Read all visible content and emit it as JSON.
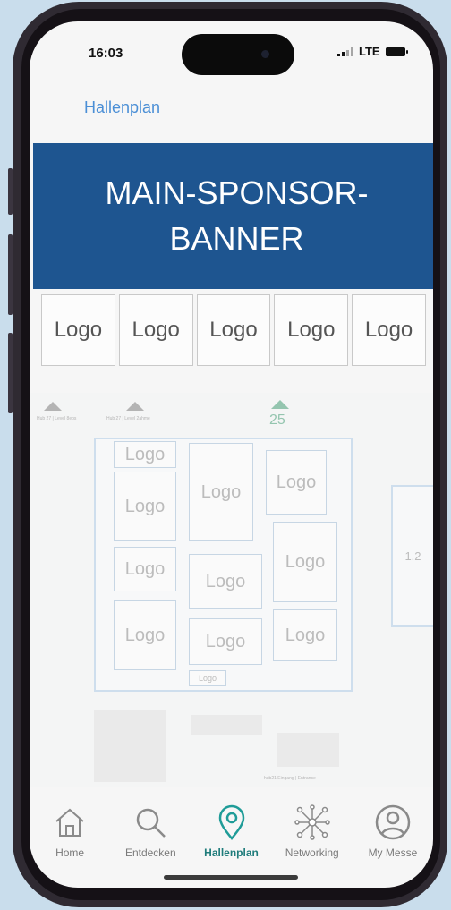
{
  "status_bar": {
    "time": "16:03",
    "network": "LTE"
  },
  "nav": {
    "title": "Hallenplan"
  },
  "banner": {
    "text": "MAIN-SPONSOR-BANNER",
    "color": "#1e5590"
  },
  "logos": {
    "row": [
      "Logo",
      "Logo",
      "Logo",
      "Logo",
      "Logo"
    ]
  },
  "map": {
    "gate": "25",
    "side_hall": "1.2",
    "booths": [
      "Logo",
      "Logo",
      "Logo",
      "Logo",
      "Logo",
      "Logo",
      "Logo",
      "Logo",
      "Logo",
      "Logo",
      "Logo"
    ],
    "labels": [
      "Hub 27 | Level 8ebs",
      "Hub 27 | Level 2ahme",
      "hub21 Eingang | Entrance"
    ]
  },
  "tabbar": {
    "items": [
      {
        "label": "Home",
        "icon": "home-icon"
      },
      {
        "label": "Entdecken",
        "icon": "search-icon"
      },
      {
        "label": "Hallenplan",
        "icon": "location-pin-icon",
        "active": true
      },
      {
        "label": "Networking",
        "icon": "network-icon"
      },
      {
        "label": "My Messe",
        "icon": "user-icon"
      }
    ],
    "active_color": "#1f7c7b"
  }
}
